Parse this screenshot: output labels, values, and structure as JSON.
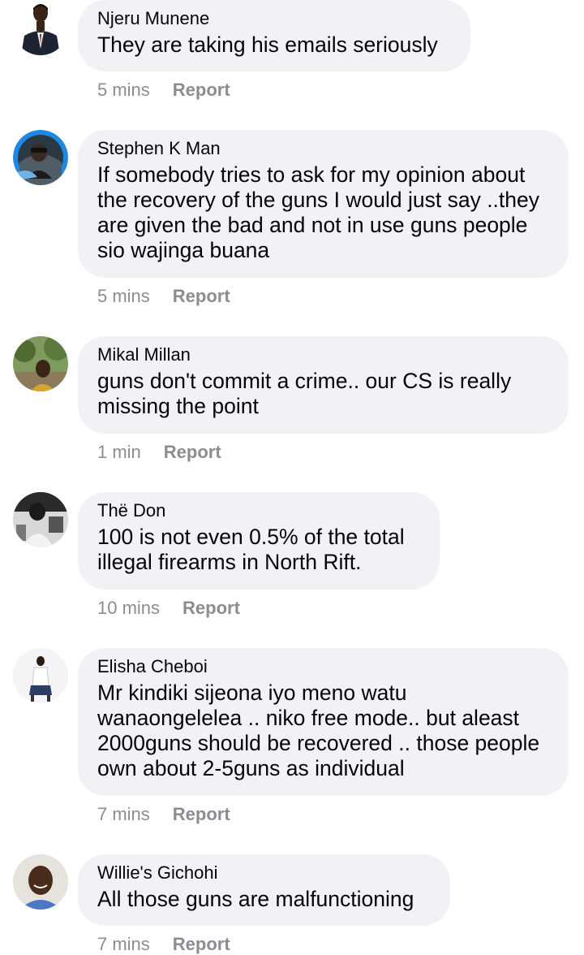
{
  "comments": [
    {
      "author": "Njeru Munene",
      "text": "They are taking his emails seriously",
      "time": "5 mins",
      "action": "Report",
      "avatar_icon": "person-in-suit-avatar"
    },
    {
      "author": "Stephen K Man",
      "text": "If somebody tries to ask for my opinion about the recovery of the guns I would just say ..they are given the bad and not in use guns people sio wajinga buana",
      "time": "5 mins",
      "action": "Report",
      "avatar_icon": "person-in-car-avatar"
    },
    {
      "author": "Mikal Millan",
      "text": "guns don't commit a crime.. our CS is really missing the point",
      "time": "1 min",
      "action": "Report",
      "avatar_icon": "person-outdoors-avatar"
    },
    {
      "author": "Thë Don",
      "text": "100 is not even 0.5% of the total illegal firearms in North Rift.",
      "time": "10 mins",
      "action": "Report",
      "avatar_icon": "black-white-photo-avatar"
    },
    {
      "author": "Elisha Cheboi",
      "text": "Mr kindiki sijeona iyo meno watu wanaongelelea .. niko free mode.. but aleast 2000guns should be recovered .. those people own about 2-5guns as individual",
      "time": "7 mins",
      "action": "Report",
      "avatar_icon": "person-sitting-avatar"
    },
    {
      "author": "Willie's Gichohi",
      "text": "All those guns are malfunctioning",
      "time": "7 mins",
      "action": "Report",
      "avatar_icon": "person-smiling-avatar"
    }
  ],
  "colors": {
    "bubble": "#f0f2f5",
    "meta": "#8a8d91",
    "text": "#050505"
  }
}
